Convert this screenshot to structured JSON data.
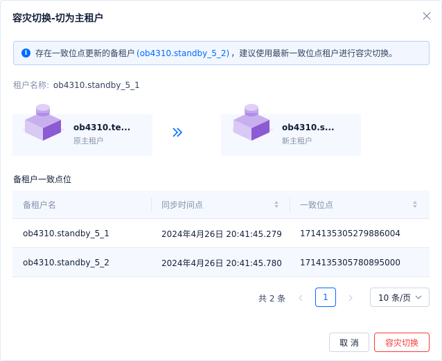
{
  "dialog": {
    "title": "容灾切换-切为主租户",
    "close_icon": "close-icon"
  },
  "alert": {
    "icon": "info-icon",
    "text_before": "存在一致位点更新的备租户",
    "link": "(ob4310.standby_5_2)",
    "text_after": "，建议使用最新一致位点租户进行容灾切换。"
  },
  "tenant": {
    "label": "租户名称:",
    "value": "ob4310.standby_5_1"
  },
  "switch": {
    "source": {
      "name": "ob4310.te...",
      "role": "原主租户",
      "icon": "tenant-cube-icon"
    },
    "arrow_icon": "double-chevron-right-icon",
    "target": {
      "name": "ob4310.s...",
      "role": "新主租户",
      "icon": "tenant-cube-icon"
    }
  },
  "section": {
    "title": "备租户一致点位"
  },
  "table": {
    "columns": [
      "备租户名",
      "同步时间点",
      "一致位点"
    ],
    "rows": [
      [
        "ob4310.standby_5_1",
        "2024年4月26日 20:41:45.279",
        "1714135305279886004"
      ],
      [
        "ob4310.standby_5_2",
        "2024年4月26日 20:41:45.780",
        "1714135305780895000"
      ]
    ]
  },
  "pagination": {
    "total": "共 2 条",
    "current": "1",
    "page_size": "10 条/页"
  },
  "footer": {
    "cancel_label": "取 消",
    "confirm_label": "容灾切换"
  },
  "colors": {
    "primary": "#006aff",
    "danger": "#f93939",
    "cube": "#9a6fd6"
  }
}
